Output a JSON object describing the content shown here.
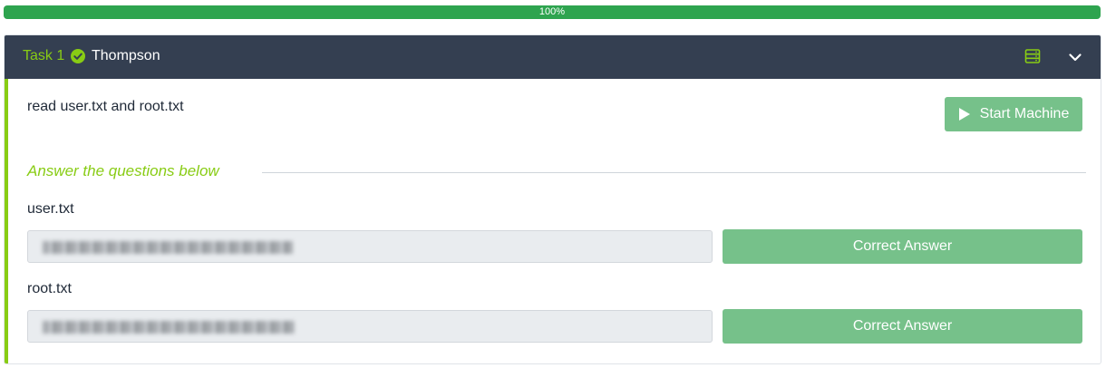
{
  "progress": {
    "label": "100%",
    "value": 1.0
  },
  "task": {
    "number_label": "Task 1",
    "title": "Thompson",
    "completed": true,
    "description": "read user.txt and root.txt",
    "start_machine_label": "Start Machine",
    "answer_heading": "Answer the questions below",
    "questions": [
      {
        "label": "user.txt",
        "answer_value": "(redacted)",
        "button_label": "Correct Answer"
      },
      {
        "label": "root.txt",
        "answer_value": "(redacted)",
        "button_label": "Correct Answer"
      }
    ]
  },
  "icons": {
    "completed": "check-circle-icon",
    "server": "server-icon",
    "collapse": "chevron-down-icon",
    "start": "play-icon"
  },
  "colors": {
    "accent": "#88cc14",
    "header_bg": "#343f51",
    "button_green": "#76c18a",
    "progress_green": "#2ea44f"
  }
}
